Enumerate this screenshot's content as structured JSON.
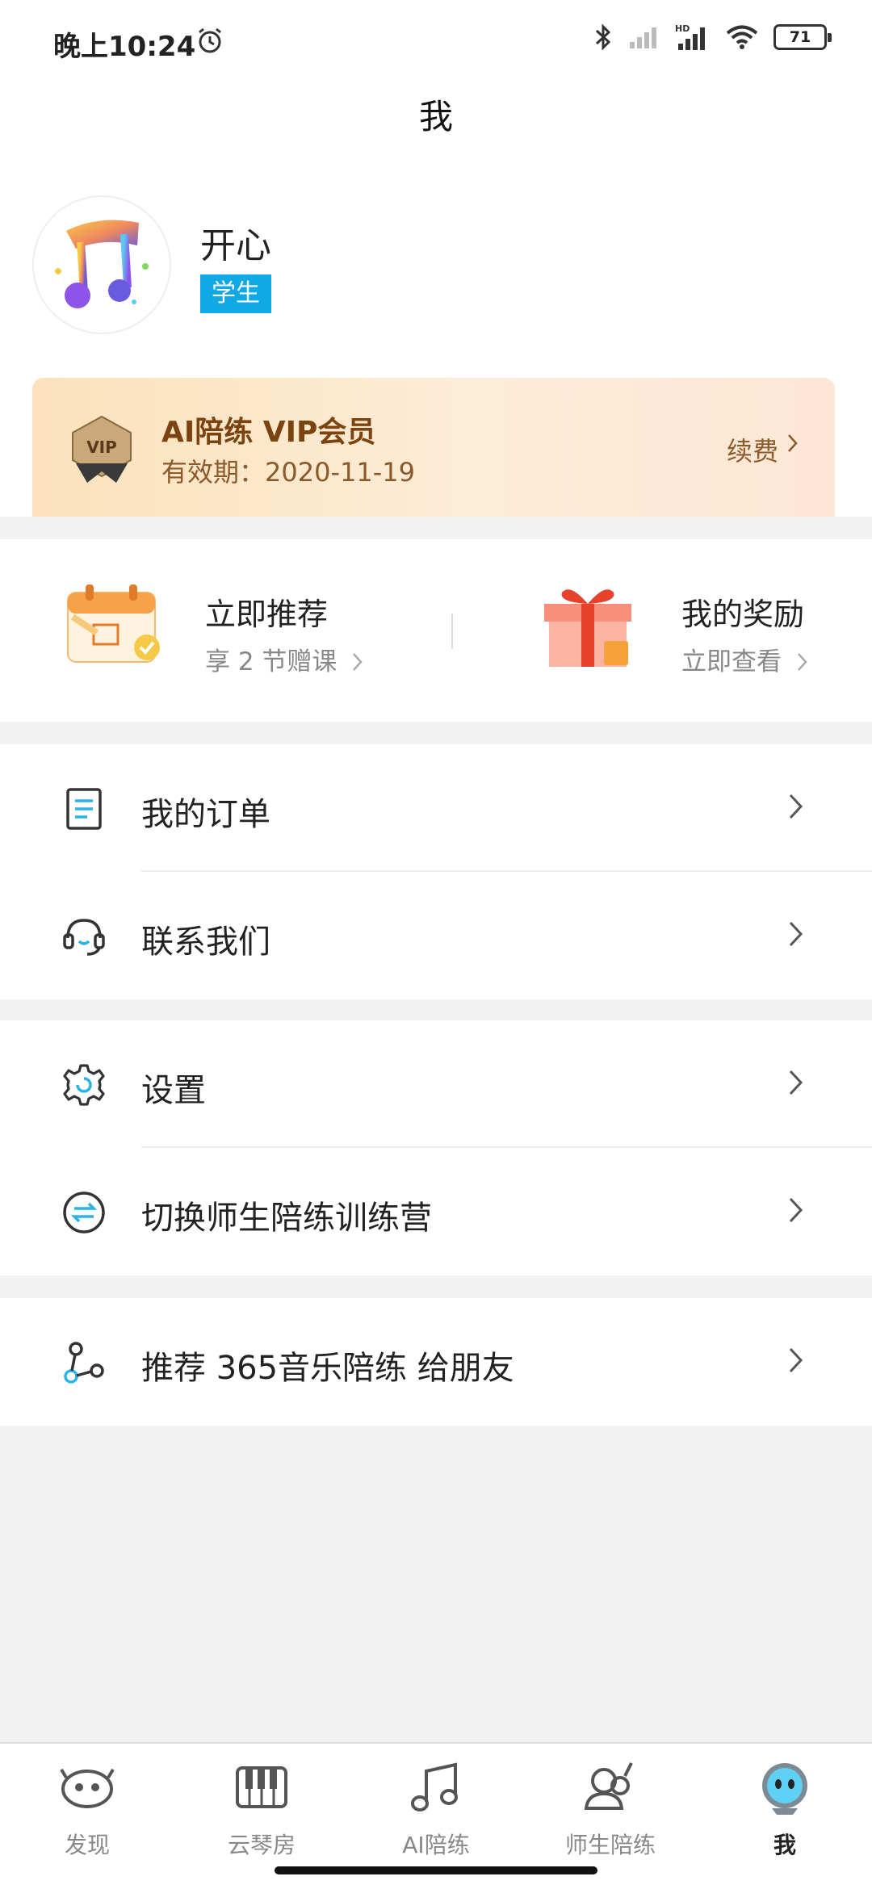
{
  "status_bar": {
    "time": "晚上10:24",
    "battery": "71"
  },
  "header": {
    "title": "我"
  },
  "profile": {
    "name": "开心",
    "role": "学生"
  },
  "vip": {
    "title": "AI陪练 VIP会员",
    "expiry": "有效期：2020-11-19",
    "renew_label": "续费",
    "badge_text": "VIP"
  },
  "promo": {
    "recommend": {
      "title": "立即推荐",
      "subtitle": "享 2 节赠课"
    },
    "rewards": {
      "title": "我的奖励",
      "subtitle": "立即查看"
    }
  },
  "menu": {
    "orders": "我的订单",
    "contact": "联系我们",
    "settings": "设置",
    "switch_camp": "切换师生陪练训练营",
    "share": "推荐 365音乐陪练 给朋友"
  },
  "tabs": [
    {
      "label": "发现",
      "icon": "discover-icon"
    },
    {
      "label": "云琴房",
      "icon": "piano-icon"
    },
    {
      "label": "AI陪练",
      "icon": "music-note-icon"
    },
    {
      "label": "师生陪练",
      "icon": "teacher-student-icon"
    },
    {
      "label": "我",
      "icon": "me-avatar-icon"
    }
  ],
  "colors": {
    "role_badge": "#11a8e6",
    "vip_title": "#7a4310",
    "background": "#f2f2f2",
    "accent_blue": "#2bb3e6"
  }
}
